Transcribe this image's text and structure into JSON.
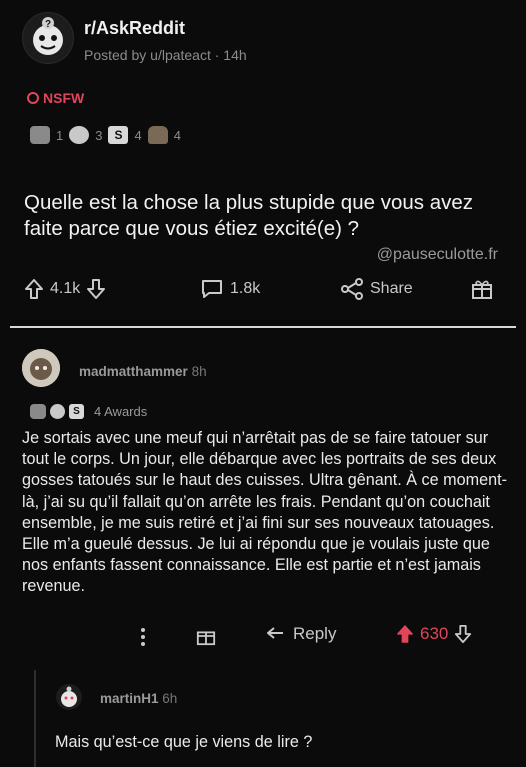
{
  "post": {
    "subreddit": "r/AskReddit",
    "posted_by": "Posted by u/lpateact · 14h",
    "nsfw_label": "NSFW",
    "awards": [
      {
        "icon": "award-icon",
        "count": "1"
      },
      {
        "icon": "wholesome-icon",
        "count": "3"
      },
      {
        "icon": "silver-icon",
        "count": "4"
      },
      {
        "icon": "poop-icon",
        "count": "4"
      }
    ],
    "title": "Quelle est la chose la plus stupide que vous avez faite parce que vous étiez excité(e) ?",
    "watermark": "@pauseculotte.fr",
    "upvotes": "4.1k",
    "comments": "1.8k",
    "share_label": "Share"
  },
  "comment": {
    "username": "madmatthammer",
    "time": "8h",
    "awards_label": "4 Awards",
    "body": "Je sortais avec une meuf qui n’arrêtait pas de se faire tatouer sur tout le corps. Un jour, elle débarque avec les portraits de ses deux gosses tatoués sur le haut des cuisses. Ultra gênant. À ce moment-là, j’ai su qu’il fallait qu’on arrête les frais. Pendant qu’on couchait ensemble, je me suis retiré et j’ai fini sur ses nouveaux tatouages. Elle m’a gueulé dessus. Je lui ai répondu que je voulais juste que nos enfants fassent connaissance. Elle est partie et n’est jamais revenue.",
    "reply_label": "Reply",
    "score": "630",
    "accent": "#e0455b"
  },
  "reply": {
    "username": "martinH1",
    "time": "6h",
    "body": "Mais qu’est-ce que je viens de lire ?"
  }
}
